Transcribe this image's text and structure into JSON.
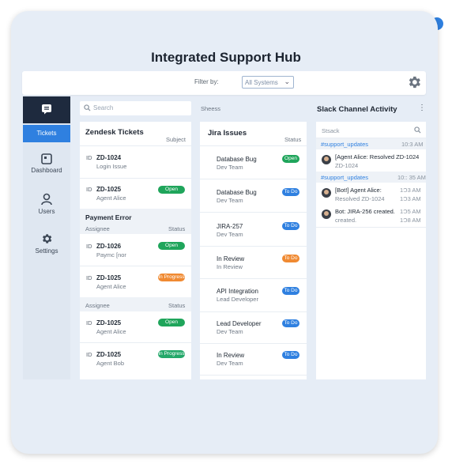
{
  "app": {
    "title": "Integrated Support Hub"
  },
  "filter": {
    "label": "Filter by:",
    "value": "All Systems"
  },
  "sidebar": {
    "items": [
      {
        "label": "Tickets",
        "icon": "chat-icon",
        "active": true
      },
      {
        "label": "Dashboard",
        "icon": "dashboard-icon"
      },
      {
        "label": "Users",
        "icon": "user-icon"
      },
      {
        "label": "Settings",
        "icon": "gear-icon"
      }
    ]
  },
  "search": {
    "placeholder": "Search"
  },
  "columns_header": "Sheess",
  "zendesk": {
    "title": "Zendesk Tickets",
    "subject_header": "Subject",
    "id_label": "ID",
    "tickets_top": [
      {
        "id": "ZD-1024",
        "sub": "Login Issue"
      },
      {
        "id": "ZD-1025",
        "sub": "Agent Alice",
        "status": "Open"
      }
    ],
    "section2": {
      "title": "Payment Error",
      "assignee_header": "Assignee",
      "status_header": "Status"
    },
    "tickets_mid": [
      {
        "id": "ZD-1026",
        "sub": "Paymc [nor",
        "status": "Open"
      },
      {
        "id": "ZD-1025",
        "sub": "Agent Alice",
        "status": "In Progress"
      }
    ],
    "section3": {
      "assignee_header": "Assignee",
      "status_header": "Status"
    },
    "tickets_bottom": [
      {
        "id": "ZD-1025",
        "sub": "Agent Alice",
        "status": "Open"
      },
      {
        "id": "ZD-1025",
        "sub": "Agent Bob",
        "status": "In Progress"
      }
    ]
  },
  "jira": {
    "title": "Jira Issues",
    "status_header": "Status",
    "issues": [
      {
        "title": "Database Bug",
        "sub": "Dev Team",
        "status": "Open"
      },
      {
        "title": "Database Bug",
        "sub": "Dev Team",
        "status": "To Do"
      },
      {
        "title": "JIRA-257",
        "sub": "Dev Team",
        "status": "To Do"
      },
      {
        "title": "In Review",
        "sub": "In Review",
        "status": "To Do"
      },
      {
        "title": "API Integration",
        "sub": "Lead Developer",
        "status": "To Do"
      },
      {
        "title": "Lead Developer",
        "sub": "Dev Team",
        "status": "To Do"
      },
      {
        "title": "In Review",
        "sub": "Dev Team",
        "status": "To Do"
      }
    ]
  },
  "slack": {
    "title": "Slack Channel Activity",
    "search_placeholder": "Stsack",
    "groups": [
      {
        "channel": "#support_updates",
        "time": "10:3 AM",
        "messages": [
          {
            "text": "[Agent Alice: Resolved ZD-1024",
            "sub": "ZD-1024"
          }
        ]
      },
      {
        "channel": "#support_updates",
        "time": "10:: 35 AM",
        "messages": [
          {
            "text": "[Bot!] Agent Alice:",
            "sub": "Resolved ZD-1024",
            "time1": "1Ɔ3 AM",
            "time2": "1Ɔ3 AM"
          },
          {
            "text": "Bot: JIRA-256 created.",
            "sub": "created.",
            "time1": "1Ɔ5 AM",
            "time2": "1Ɔ8 AM"
          }
        ]
      }
    ]
  }
}
